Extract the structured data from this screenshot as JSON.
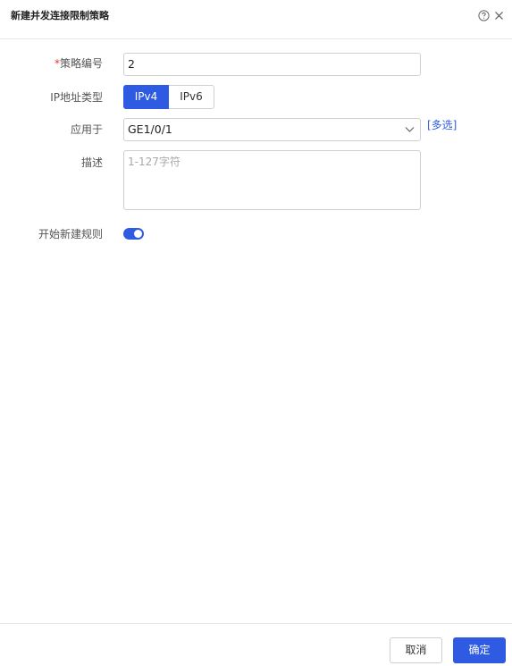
{
  "dialog": {
    "title": "新建并发连接限制策略",
    "help_icon": "question-circle-icon",
    "close_icon": "close-icon"
  },
  "form": {
    "policy_id": {
      "required_mark": "*",
      "label": "策略编号",
      "value": "2"
    },
    "ip_type": {
      "label": "IP地址类型",
      "options": [
        "IPv4",
        "IPv6"
      ],
      "selected": "IPv4"
    },
    "apply_to": {
      "label": "应用于",
      "value": "GE1/0/1",
      "multi_select_link": "[多选]"
    },
    "description": {
      "label": "描述",
      "placeholder": "1-127字符",
      "value": ""
    },
    "start_new_rule": {
      "label": "开始新建规则",
      "enabled": true
    }
  },
  "footer": {
    "cancel_label": "取消",
    "ok_label": "确定"
  },
  "colors": {
    "accent": "#2f5be3",
    "required": "#e53935"
  }
}
